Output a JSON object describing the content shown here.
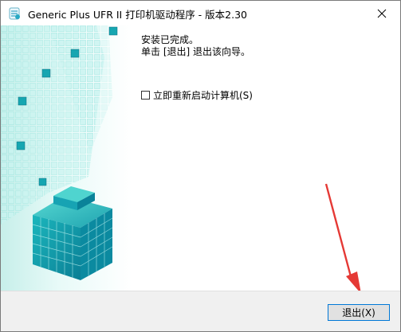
{
  "window": {
    "title": "Generic Plus UFR II 打印机驱动程序 - 版本2.30"
  },
  "content": {
    "line1": "安装已完成。",
    "line2": "单击 [退出] 退出该向导。"
  },
  "restart_option": {
    "label": "立即重新启动计算机(S)",
    "checked": false
  },
  "footer": {
    "exit_label": "退出(X)"
  },
  "colors": {
    "accent": "#0078d7",
    "cube_teal": "#26b6b6",
    "annotation_arrow": "#e53935"
  },
  "icons": {
    "app": "printer-driver-icon",
    "close": "close-icon"
  }
}
